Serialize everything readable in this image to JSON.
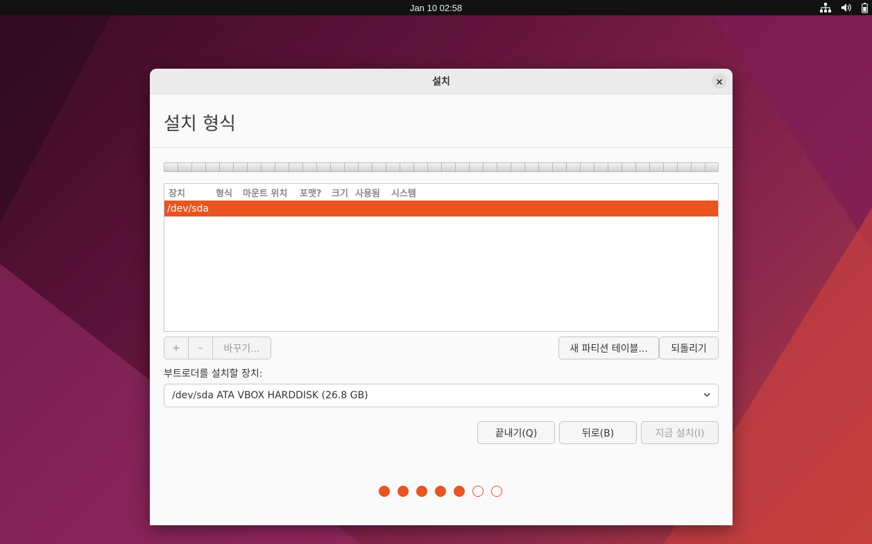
{
  "topbar": {
    "clock": "Jan 10  02:58"
  },
  "window": {
    "title": "설치",
    "heading": "설치 형식"
  },
  "table": {
    "columns": [
      "장치",
      "형식",
      "마운트 위치",
      "포맷?",
      "크기",
      "사용됨",
      "시스템"
    ],
    "rows": [
      {
        "device": "/dev/sda",
        "selected": true
      }
    ]
  },
  "partition_tools": {
    "add": "+",
    "remove": "–",
    "change": "바꾸기...",
    "new_table": "새 파티션 테이블...",
    "revert": "되돌리기"
  },
  "bootloader": {
    "label": "부트로더를 설치할 장치:",
    "selected": "/dev/sda ATA VBOX HARDDISK (26.8 GB)"
  },
  "actions": {
    "quit": "끝내기(Q)",
    "back": "뒤로(B)",
    "install": "지금 설치(I)"
  },
  "progress": {
    "current_step": 5,
    "total_steps": 7
  },
  "colors": {
    "accent": "#e95420"
  }
}
